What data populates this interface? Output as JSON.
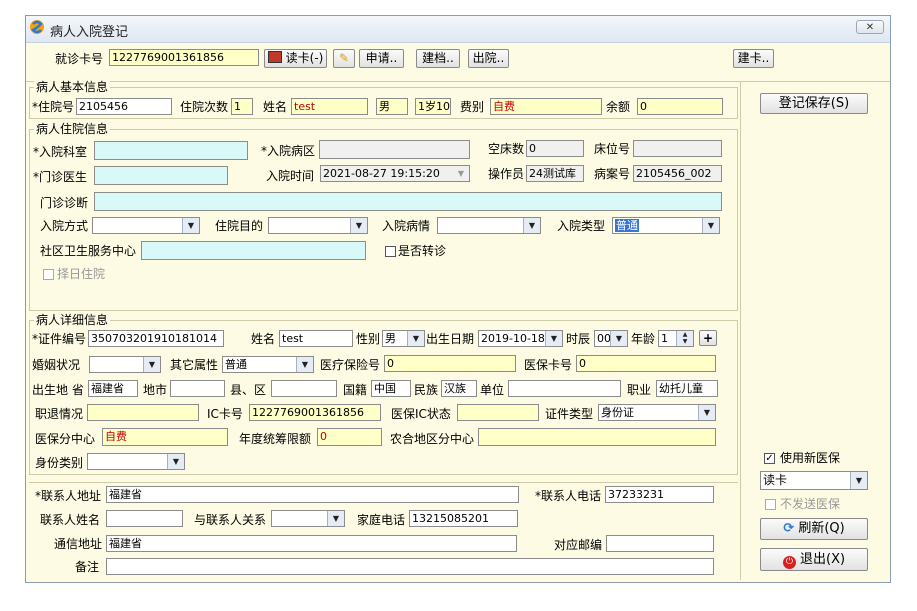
{
  "window": {
    "title": "病人入院登记",
    "close": "✕"
  },
  "top": {
    "card_label": "就诊卡号",
    "card_value": "1227769001361856",
    "read_card": "读卡(-)",
    "apply": "申请..",
    "create_file": "建档..",
    "discharge": "出院..",
    "create_card": "建卡.."
  },
  "basic": {
    "title": "病人基本信息",
    "inpatient_no_label": "*住院号",
    "inpatient_no": "2105456",
    "times_label": "住院次数",
    "times": "1",
    "name_label": "姓名",
    "name": "test",
    "sex": "男",
    "age": "1岁10",
    "fee_type_label": "费别",
    "fee_type": "自费",
    "balance_label": "余额",
    "balance": "0"
  },
  "admission": {
    "title": "病人住院信息",
    "dept_label": "*入院科室",
    "dept": "",
    "ward_label": "*入院病区",
    "ward": "",
    "empty_bed_label": "空床数",
    "empty_bed": "0",
    "bed_label": "床位号",
    "bed": "",
    "doctor_label": "*门诊医生",
    "doctor": "",
    "time_label": "入院时间",
    "time": "2021-08-27 19:15:20",
    "operator_label": "操作员",
    "operator": "24测试库",
    "record_no_label": "病案号",
    "record_no": "2105456_002",
    "diagnosis_label": "门诊诊断",
    "diagnosis": "",
    "mode_label": "入院方式",
    "mode": "",
    "purpose_label": "住院目的",
    "purpose": "",
    "condition_label": "入院病情",
    "condition": "",
    "type_label": "入院类型",
    "type": "普通",
    "community_label": "社区卫生服务中心",
    "community": "",
    "transfer_label": "是否转诊",
    "select_day_label": "择日住院"
  },
  "detail": {
    "title": "病人详细信息",
    "id_no_label": "*证件编号",
    "id_no": "350703201910181014",
    "name_label": "姓名",
    "name": "test",
    "sex_label": "性别",
    "sex": "男",
    "birth_label": "出生日期",
    "birth": "2019-10-18",
    "hour_label": "时辰",
    "hour": "00",
    "age_label": "年龄",
    "age": "1",
    "marital_label": "婚姻状况",
    "marital": "",
    "other_label": "其它属性",
    "other": "普通",
    "insurance_no_label": "医疗保险号",
    "insurance_no": "0",
    "insurance_card_label": "医保卡号",
    "insurance_card": "0",
    "birthplace_label": "出生地 省",
    "province": "福建省",
    "city_label": "地市",
    "city": "",
    "county_label": "县、区",
    "county": "",
    "nation_label": "国籍",
    "nation": "中国",
    "ethnic_label": "民族",
    "ethnic": "汉族",
    "unit_label": "单位",
    "unit": "",
    "job_label": "职业",
    "job": "幼托儿童",
    "retire_label": "职退情况",
    "retire": "",
    "ic_label": "IC卡号",
    "ic": "1227769001361856",
    "ic_status_label": "医保IC状态",
    "ic_status": "",
    "cert_type_label": "证件类型",
    "cert_type": "身份证",
    "ins_center_label": "医保分中心",
    "ins_center": "自费",
    "quota_label": "年度统筹限额",
    "quota": "0",
    "rural_label": "农合地区分中心",
    "rural": "",
    "identity_label": "身份类别",
    "identity": ""
  },
  "contact": {
    "addr_label": "*联系人地址",
    "addr": "福建省",
    "phone_label": "*联系人电话",
    "phone": "37233231",
    "name_label": "联系人姓名",
    "name": "",
    "relation_label": "与联系人关系",
    "relation": "",
    "home_phone_label": "家庭电话",
    "home_phone": "13215085201",
    "mail_label": "通信地址",
    "mail": "福建省",
    "zip_label": "对应邮编",
    "zip": "",
    "remark_label": "备注",
    "remark": ""
  },
  "side": {
    "save": "登记保存(S)",
    "new_ins": "使用新医保",
    "read_mode": "读卡",
    "no_send": "不发送医保",
    "refresh": "刷新(Q)",
    "exit": "退出(X)"
  }
}
